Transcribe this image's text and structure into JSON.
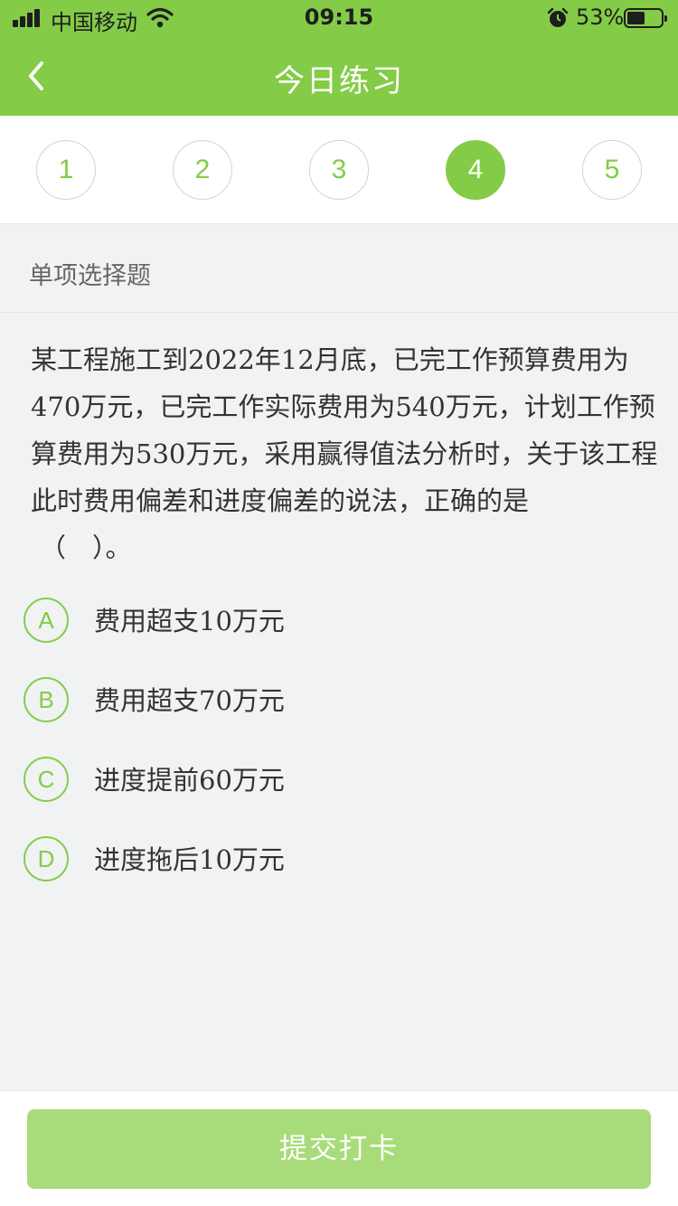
{
  "status_bar": {
    "carrier": "中国移动",
    "time": "09:15",
    "battery_percent": "53%",
    "battery_level": 0.53,
    "icons": [
      "signal-icon",
      "wifi-icon",
      "alarm-icon",
      "battery-icon"
    ]
  },
  "nav": {
    "title": "今日练习",
    "back_icon": "chevron-left-icon"
  },
  "steps": {
    "items": [
      "1",
      "2",
      "3",
      "4",
      "5"
    ],
    "active": "4"
  },
  "question": {
    "type": "单项选择题",
    "text": "某工程施工到2022年12月底，已完工作预算费用为470万元，已完工作实际费用为540万元，计划工作预算费用为530万元，采用赢得值法分析时，关于该工程此时费用偏差和进度偏差的说法，正确的是",
    "blank": "（　）。",
    "options": [
      {
        "letter": "A",
        "text": "费用超支10万元"
      },
      {
        "letter": "B",
        "text": "费用超支70万元"
      },
      {
        "letter": "C",
        "text": "进度提前60万元"
      },
      {
        "letter": "D",
        "text": "进度拖后10万元"
      }
    ]
  },
  "footer": {
    "submit_label": "提交打卡"
  },
  "colors": {
    "accent": "#84cc47",
    "submit_bg": "#a8dc7a",
    "page_bg": "#f1f2f4"
  }
}
